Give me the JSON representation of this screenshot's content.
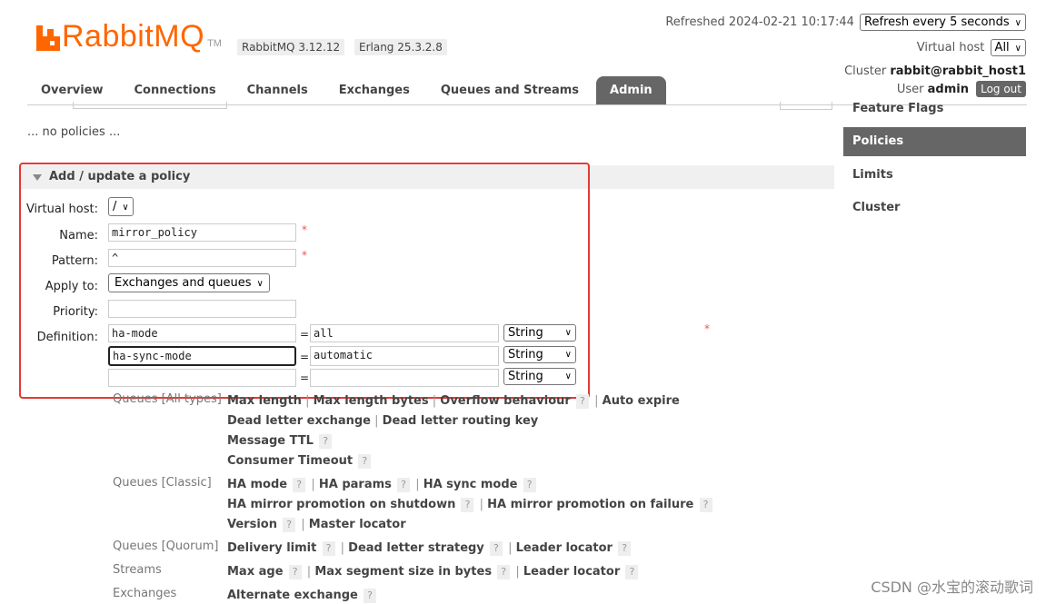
{
  "header": {
    "logo_text": "RabbitMQ",
    "logo_tm": "TM",
    "rabbitmq_version": "RabbitMQ 3.12.12",
    "erlang_version": "Erlang 25.3.2.8",
    "refreshed_label": "Refreshed 2024-02-21 10:17:44",
    "refresh_select": "Refresh every 5 seconds",
    "virtual_host_label": "Virtual host",
    "virtual_host_select": "All",
    "cluster_label": "Cluster",
    "cluster_name": "rabbit@rabbit_host1",
    "user_label": "User",
    "user_name": "admin",
    "logout_label": "Log out"
  },
  "tabs": [
    {
      "label": "Overview"
    },
    {
      "label": "Connections"
    },
    {
      "label": "Channels"
    },
    {
      "label": "Exchanges"
    },
    {
      "label": "Queues and Streams"
    },
    {
      "label": "Admin"
    }
  ],
  "sidebar": {
    "items": [
      {
        "label": "Feature Flags"
      },
      {
        "label": "Policies"
      },
      {
        "label": "Limits"
      },
      {
        "label": "Cluster"
      }
    ]
  },
  "main": {
    "no_policies_text": "... no policies ...",
    "section_title": "Add / update a policy"
  },
  "form": {
    "vhost_label": "Virtual host:",
    "vhost_value": "/",
    "name_label": "Name:",
    "name_value": "mirror_policy",
    "pattern_label": "Pattern:",
    "pattern_value": "^",
    "apply_label": "Apply to:",
    "apply_value": "Exchanges and queues",
    "priority_label": "Priority:",
    "priority_value": "",
    "definition_label": "Definition:",
    "required_mark": "*",
    "eq": "=",
    "definitions": [
      {
        "key": "ha-mode",
        "value": "all",
        "type": "String"
      },
      {
        "key": "ha-sync-mode",
        "value": "automatic",
        "type": "String"
      },
      {
        "key": "",
        "value": "",
        "type": "String"
      }
    ]
  },
  "help": {
    "queues_all_label": "Queues [All types]",
    "queues_all_row1": [
      "Max length",
      "Max length bytes",
      "Overflow behaviour",
      "Auto expire"
    ],
    "queues_all_row2": [
      "Dead letter exchange",
      "Dead letter routing key"
    ],
    "message_ttl": "Message TTL",
    "consumer_timeout": "Consumer Timeout",
    "queues_classic_label": "Queues [Classic]",
    "classic_row1": [
      "HA mode",
      "HA params",
      "HA sync mode"
    ],
    "classic_row2": [
      "HA mirror promotion on shutdown",
      "HA mirror promotion on failure"
    ],
    "classic_row3": [
      "Version",
      "Master locator"
    ],
    "queues_quorum_label": "Queues [Quorum]",
    "quorum_row": [
      "Delivery limit",
      "Dead letter strategy",
      "Leader locator"
    ],
    "streams_label": "Streams",
    "streams_row": [
      "Max age",
      "Max segment size in bytes",
      "Leader locator"
    ],
    "exchanges_label": "Exchanges",
    "exchanges_row": [
      "Alternate exchange"
    ],
    "sep": "|",
    "qmark": "?"
  },
  "watermark": "CSDN @水宝的滚动歌词"
}
